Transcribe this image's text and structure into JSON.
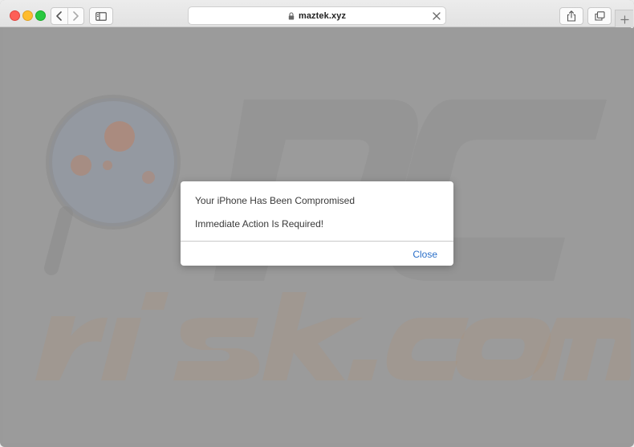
{
  "browser": {
    "address_bar": {
      "url": "maztek.xyz"
    },
    "icons": {
      "back": "chevron-left-icon",
      "forward": "chevron-right-icon",
      "sidebar": "sidebar-icon",
      "lock": "lock-icon",
      "stop": "close-x-icon",
      "share": "share-icon",
      "tabs": "tabs-overview-icon",
      "new_tab": "plus-icon"
    }
  },
  "page": {
    "watermark_text": "PCrisk.com"
  },
  "alert": {
    "message_line1": "Your iPhone Has Been Compromised",
    "message_line2": "Immediate Action Is Required!",
    "close_label": "Close"
  },
  "colors": {
    "accent_link": "#2a6fc9",
    "overlay_background": "#9b9b9b",
    "traffic_close": "#fe5f57",
    "traffic_minimize": "#febc2e",
    "traffic_maximize": "#28c840"
  }
}
